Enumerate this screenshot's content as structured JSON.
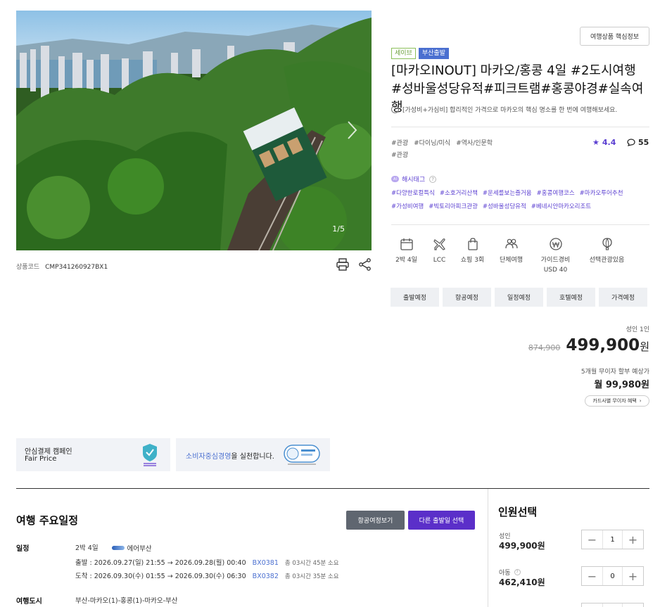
{
  "hero": {
    "counter": "1/5"
  },
  "product_code": {
    "label": "상품코드",
    "value": "CMP341260927BX1"
  },
  "core_info_button": "여행상품 핵심정보",
  "badges": [
    "세이브",
    "부산출발"
  ],
  "title": "[마카오INOUT] 마카오/홍콩 4일 #2도시여행#성바울성당유적#피크트램#홍콩야경#실속여행",
  "subnote": "[가성비+가심비] 합리적인 가격으로 마카오의 핵심 명소를 한 번에 여행해보세요.",
  "tags": [
    "#관광",
    "#다이닝/미식",
    "#역사/인문학",
    "#관광"
  ],
  "rating": "4.4",
  "reviews": "55",
  "hashtag_label": "해시태그",
  "hashtag_ai": "AI",
  "hashtags": [
    "#다양한로컬특식",
    "#소호거리산책",
    "#운세를보는즐거움",
    "#홍콩여행코스",
    "#마카오투어추천",
    "#가성비여행",
    "#빅토리아피크관광",
    "#성바울성당유적",
    "#베네시안마카오리조트"
  ],
  "features": [
    {
      "icon": "calendar-icon",
      "line1": "2박 4일",
      "line2": ""
    },
    {
      "icon": "plane-icon",
      "line1": "LCC",
      "line2": ""
    },
    {
      "icon": "shopping-bag-icon",
      "line1": "쇼핑 3회",
      "line2": ""
    },
    {
      "icon": "group-icon",
      "line1": "단체여행",
      "line2": ""
    },
    {
      "icon": "won-icon",
      "line1": "가이드경비",
      "line2": "USD 40"
    },
    {
      "icon": "balloon-icon",
      "line1": "선택관광있음",
      "line2": ""
    }
  ],
  "tabs": [
    "출발예정",
    "항공예정",
    "일정예정",
    "호텔예정",
    "가격예정"
  ],
  "pricing": {
    "pax_label": "성인 1인",
    "original": "874,900",
    "price": "499,900",
    "currency": "원",
    "installment_note": "5개월 무이자 할부 예상가",
    "installment_price": "월 99,980원",
    "card_button": "카드사별 무이자 혜택"
  },
  "banners": {
    "campaign_line1": "안심결제 캠페인",
    "campaign_line2": "Fair Price",
    "consumer_em": "소비자중심경영",
    "consumer_rest": "을 실천합니다."
  },
  "schedule": {
    "title": "여행 주요일정",
    "flight_button": "항공여정보기",
    "date_button": "다른 출발일 선택",
    "itinerary_label": "일정",
    "duration": "2박 4일",
    "airline": "에어부산",
    "departure": {
      "prefix": "출발 : 2026.09.27(일) 21:55",
      "arrive": "2026.09.28(월) 00:40",
      "code": "BX0381",
      "total": "총 03시간 45분 소요"
    },
    "return": {
      "prefix": "도착 : 2026.09.30(수) 01:55",
      "arrive": "2026.09.30(수) 06:30",
      "code": "BX0382",
      "total": "총 03시간 35분 소요"
    },
    "cities_label": "여행도시",
    "cities": "부산-마카오(1)-홍콩(1)-마카오-부산"
  },
  "passengers": {
    "title": "인원선택",
    "adult": {
      "label": "성인",
      "price": "499,900원",
      "count": "1"
    },
    "child": {
      "label": "아동",
      "price": "462,410원",
      "count": "0"
    }
  },
  "colors": {
    "accent": "#5b2fc9",
    "link": "#4a6fd0",
    "badge_green": "#6a9f3a"
  }
}
